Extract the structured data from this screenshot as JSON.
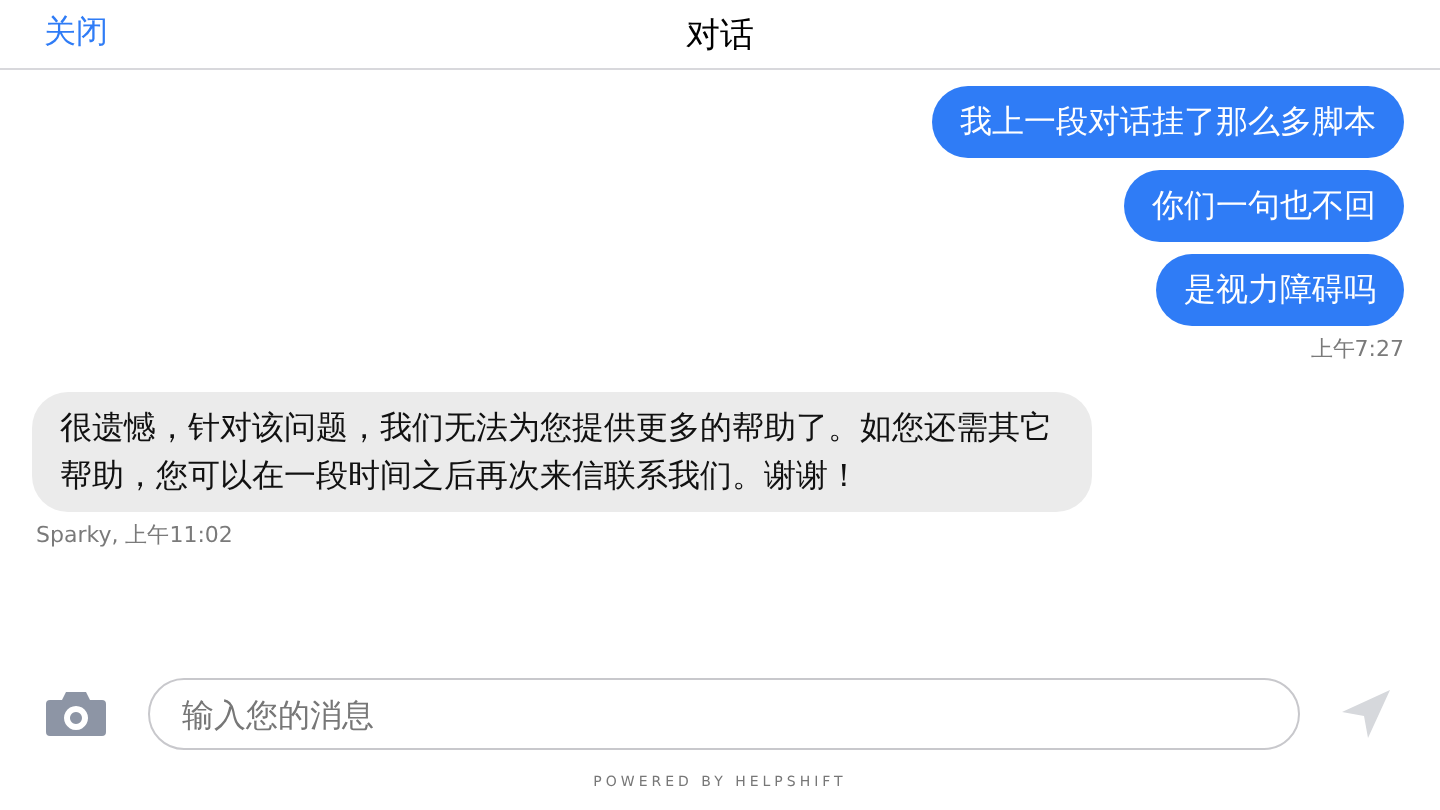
{
  "header": {
    "close": "关闭",
    "title": "对话"
  },
  "groups": [
    {
      "kind": "outgoing",
      "messages": [
        "我上一段对话挂了那么多脚本",
        "你们一句也不回",
        "是视力障碍吗"
      ],
      "meta": "上午7:27"
    },
    {
      "kind": "incoming",
      "messages": [
        "很遗憾，针对该问题，我们无法为您提供更多的帮助了。如您还需其它帮助，您可以在一段时间之后再次来信联系我们。谢谢！"
      ],
      "meta": "Sparky, 上午11:02"
    }
  ],
  "composer": {
    "placeholder": "输入您的消息"
  },
  "footer": "POWERED BY HELPSHIFT"
}
